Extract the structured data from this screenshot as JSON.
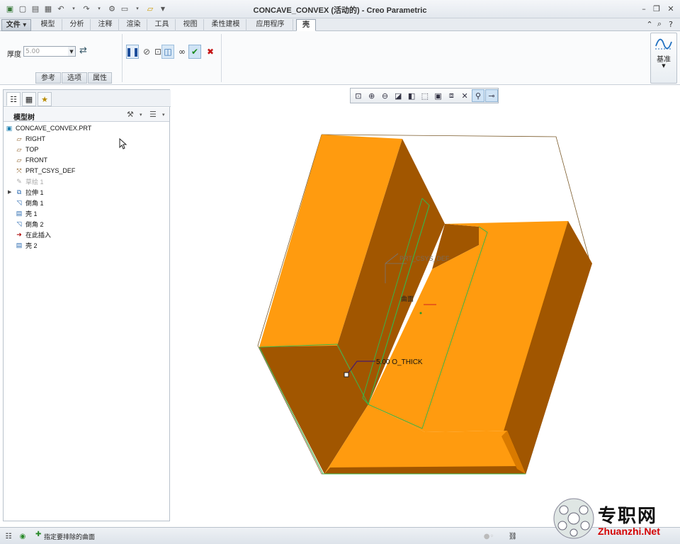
{
  "window": {
    "title": "CONCAVE_CONVEX (活动的) - Creo Parametric"
  },
  "menu": {
    "tabs": [
      "文件",
      "模型",
      "分析",
      "注释",
      "渲染",
      "工具",
      "视图",
      "柔性建模",
      "应用程序",
      "壳"
    ],
    "active": "壳"
  },
  "ribbon": {
    "thickness_label": "厚度",
    "thickness_value": "5.00",
    "subtabs": [
      "参考",
      "选项",
      "属性"
    ],
    "datum_label": "基准"
  },
  "model_tree": {
    "title": "模型树",
    "items": [
      {
        "label": "CONCAVE_CONVEX.PRT",
        "icon": "part-icon"
      },
      {
        "label": "RIGHT",
        "icon": "datum-plane-icon"
      },
      {
        "label": "TOP",
        "icon": "datum-plane-icon"
      },
      {
        "label": "FRONT",
        "icon": "datum-plane-icon"
      },
      {
        "label": "PRT_CSYS_DEF",
        "icon": "csys-icon"
      },
      {
        "label": "草绘 1",
        "icon": "sketch-icon"
      },
      {
        "label": "拉伸 1",
        "icon": "extrude-icon"
      },
      {
        "label": "倒角 1",
        "icon": "chamfer-icon"
      },
      {
        "label": "壳 1",
        "icon": "shell-icon"
      },
      {
        "label": "倒角 2",
        "icon": "chamfer-icon"
      },
      {
        "label": "在此插入",
        "icon": "insert-arrow-icon"
      },
      {
        "label": "壳 2",
        "icon": "shell-icon"
      }
    ]
  },
  "viewport": {
    "csys_label": "PRT_CSYS_DEF",
    "surface_label": "曲面",
    "dimension_label": "5.00 O_THICK",
    "model_color": "#ff9b0f",
    "model_dark": "#a15600",
    "model_mid": "#d97a00"
  },
  "status": {
    "message": "指定要排除的曲面"
  },
  "watermark": {
    "cn": "专职网",
    "en": "Zhuanzhi.Net"
  }
}
